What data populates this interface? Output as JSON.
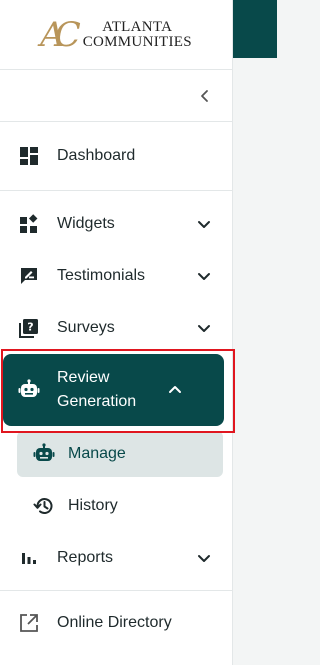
{
  "brand": {
    "mark": "AC",
    "line1": "ATLANTA",
    "line2": "COMMUNITIES"
  },
  "colors": {
    "primary": "#08494a",
    "highlight": "#e0161f",
    "sub_active_bg": "#dde5e5",
    "brand_gold": "#b8955a"
  },
  "nav": {
    "collapse_icon": "chevron-left-icon",
    "dashboard": "Dashboard",
    "widgets": "Widgets",
    "testimonials": "Testimonials",
    "surveys": "Surveys",
    "review_generation": "Review Generation",
    "review_sub": [
      {
        "label": "Manage",
        "icon": "robot-icon"
      },
      {
        "label": "History",
        "icon": "history-icon"
      }
    ],
    "reports": "Reports",
    "online_directory": "Online Directory"
  }
}
